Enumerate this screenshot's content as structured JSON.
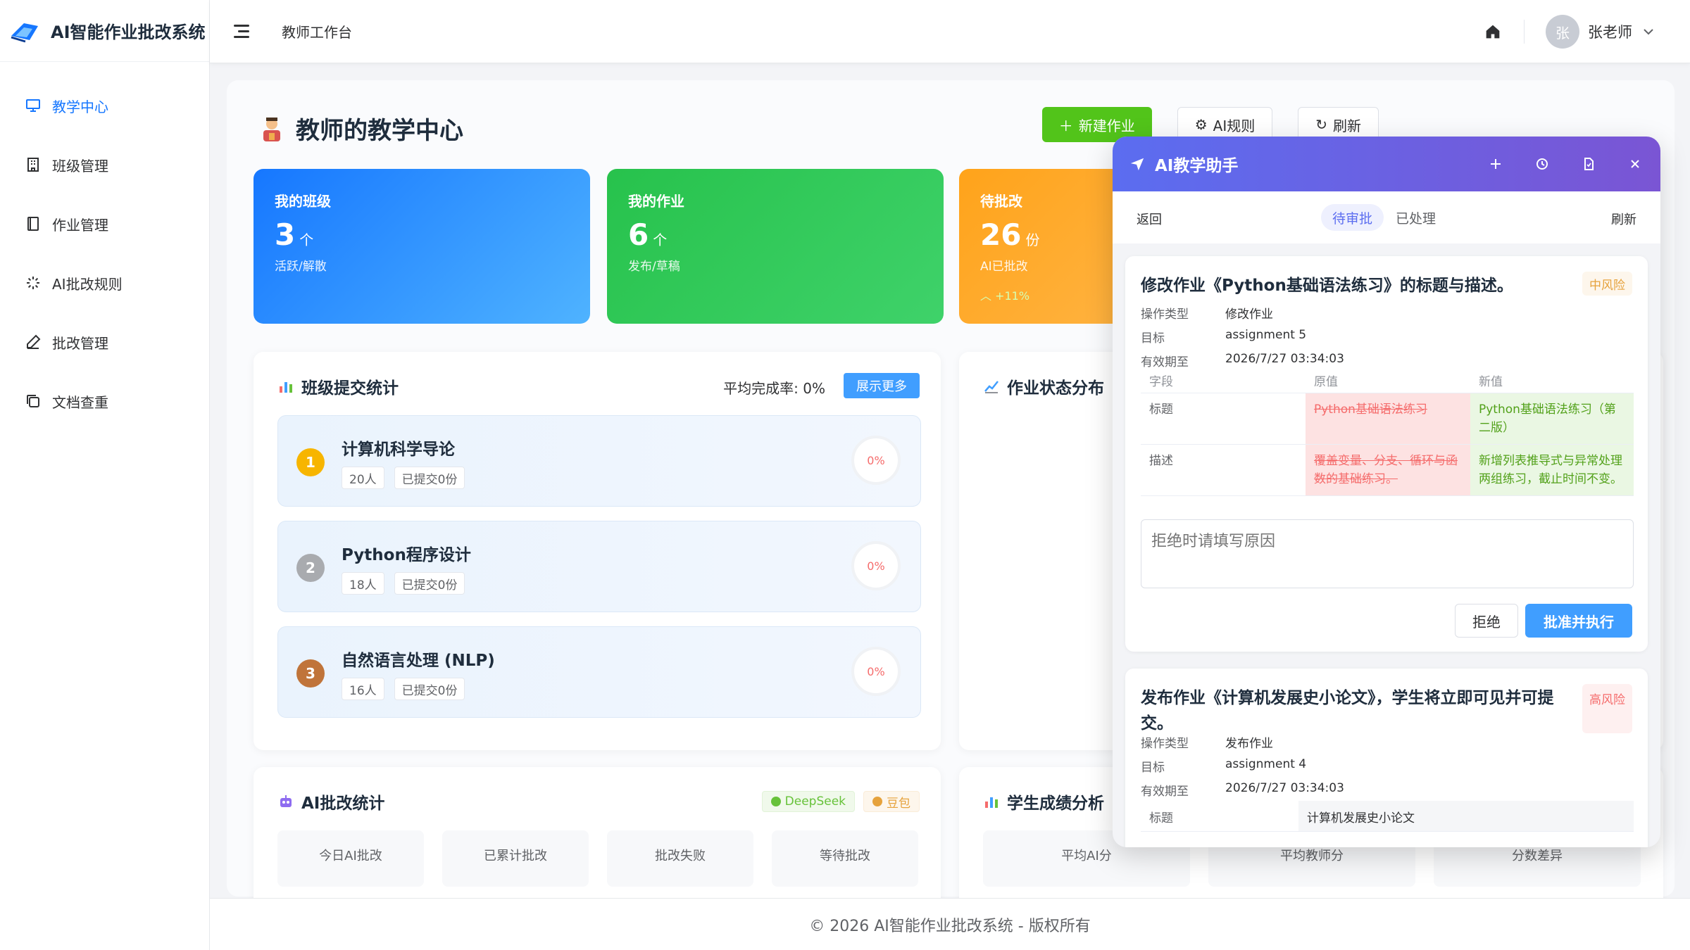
{
  "app": {
    "title": "AI智能作业批改系统"
  },
  "sidebar": {
    "items": [
      {
        "label": "教学中心",
        "icon": "monitor-icon",
        "active": true
      },
      {
        "label": "班级管理",
        "icon": "building-icon"
      },
      {
        "label": "作业管理",
        "icon": "notebook-icon"
      },
      {
        "label": "AI批改规则",
        "icon": "spinner-icon"
      },
      {
        "label": "批改管理",
        "icon": "pen-icon"
      },
      {
        "label": "文档查重",
        "icon": "copy-icon"
      }
    ]
  },
  "header": {
    "breadcrumb": "教师工作台",
    "avatar": "张",
    "user": "张老师"
  },
  "page": {
    "title": "教师的教学中心",
    "buttons": {
      "new": "新建作业",
      "rules": "AI规则",
      "refresh": "刷新"
    }
  },
  "stats": {
    "classes": {
      "label": "我的班级",
      "value": "3",
      "unit": "个",
      "sub": "活跃/解散"
    },
    "homework": {
      "label": "我的作业",
      "value": "6",
      "unit": "个",
      "sub": "发布/草稿"
    },
    "pending": {
      "label": "待批改",
      "value": "26",
      "unit": "份",
      "sub": "AI已批改",
      "trend": "+11%"
    }
  },
  "class_panel": {
    "title": "班级提交统计",
    "avg_rate": "平均完成率: 0%",
    "more": "展示更多",
    "items": [
      {
        "rank": "1",
        "name": "计算机科学导论",
        "students": "20人",
        "submitted": "已提交0份",
        "pct": "0%"
      },
      {
        "rank": "2",
        "name": "Python程序设计",
        "students": "18人",
        "submitted": "已提交0份",
        "pct": "0%"
      },
      {
        "rank": "3",
        "name": "自然语言处理 (NLP)",
        "students": "16人",
        "submitted": "已提交0份",
        "pct": "0%"
      }
    ]
  },
  "status_panel": {
    "title": "作业状态分布"
  },
  "ai_panel": {
    "title": "AI批改统计",
    "models": [
      "DeepSeek",
      "豆包"
    ],
    "stats": [
      "今日AI批改",
      "已累计批改",
      "批改失败",
      "等待批改"
    ]
  },
  "score_panel": {
    "title": "学生成绩分析",
    "stats": [
      "平均AI分",
      "平均教师分",
      "分数差异"
    ]
  },
  "footer": {
    "text": "© 2026 AI智能作业批改系统 - 版权所有"
  },
  "assistant": {
    "title": "AI教学助手",
    "back": "返回",
    "tabs": {
      "pending": "待审批",
      "done": "已处理"
    },
    "refresh": "刷新",
    "request1": {
      "title": "修改作业《Python基础语法练习》的标题与描述。",
      "risk": "中风险",
      "meta": [
        {
          "k": "操作类型",
          "v": "修改作业"
        },
        {
          "k": "目标",
          "v": "assignment 5"
        },
        {
          "k": "有效期至",
          "v": "2026/7/27 03:34:03"
        }
      ],
      "diff_headers": {
        "field": "字段",
        "old": "原值",
        "new": "新值"
      },
      "diff_rows": [
        {
          "field": "标题",
          "old": "Python基础语法练习",
          "new": "Python基础语法练习（第二版）"
        },
        {
          "field": "描述",
          "old": "覆盖变量、分支、循环与函数的基础练习。",
          "new": "新增列表推导式与异常处理两组练习，截止时间不变。"
        }
      ],
      "reason_placeholder": "拒绝时请填写原因",
      "reject": "拒绝",
      "approve": "批准并执行"
    },
    "request2": {
      "title": "发布作业《计算机发展史小论文》，学生将立即可见并可提交。",
      "risk": "高风险",
      "meta": [
        {
          "k": "操作类型",
          "v": "发布作业"
        },
        {
          "k": "目标",
          "v": "assignment 4"
        },
        {
          "k": "有效期至",
          "v": "2026/7/27 03:34:03"
        }
      ],
      "rows": [
        {
          "field": "标题",
          "value": "计算机发展史小论文"
        }
      ]
    }
  },
  "colors": {
    "primary": "#409eff",
    "green": "#52c41a",
    "orange": "#ffa31a",
    "assistant_header": "#6a60e2"
  }
}
